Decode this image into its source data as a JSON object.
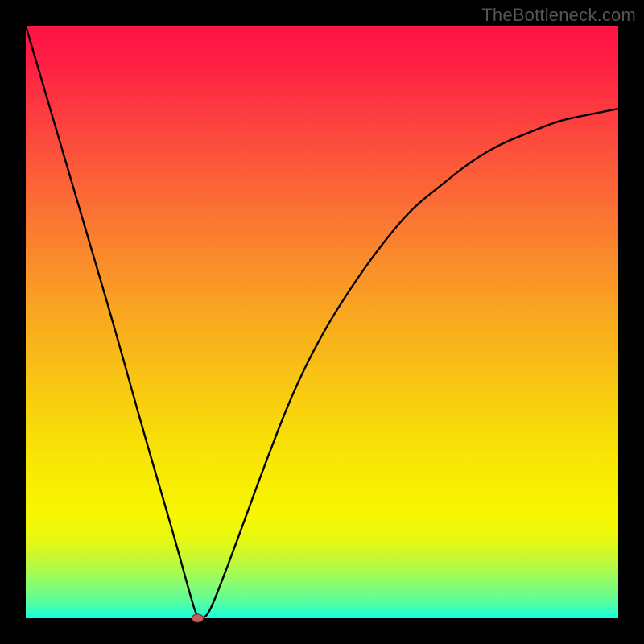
{
  "watermark": "TheBottleneck.com",
  "chart_data": {
    "type": "line",
    "title": "",
    "xlabel": "",
    "ylabel": "",
    "xlim": [
      0,
      100
    ],
    "ylim": [
      0,
      100
    ],
    "grid": false,
    "legend": false,
    "series": [
      {
        "name": "bottleneck-curve",
        "x": [
          0,
          5,
          10,
          15,
          20,
          25,
          28,
          29,
          30,
          31,
          33,
          36,
          40,
          45,
          50,
          55,
          60,
          65,
          70,
          75,
          80,
          85,
          90,
          95,
          100
        ],
        "y": [
          100,
          83,
          66,
          49,
          31,
          14,
          3,
          0,
          0,
          1,
          6,
          14,
          25,
          38,
          48,
          56,
          63,
          69,
          73,
          77,
          80,
          82,
          84,
          85,
          86
        ]
      }
    ],
    "markers": [
      {
        "name": "minimum-point",
        "x": 29,
        "y": 0,
        "color": "#c0635a"
      }
    ],
    "annotations": []
  },
  "colors": {
    "curve": "#000000",
    "marker_fill": "#c0635a",
    "marker_stroke": "#6a3030",
    "frame": "#000000"
  }
}
